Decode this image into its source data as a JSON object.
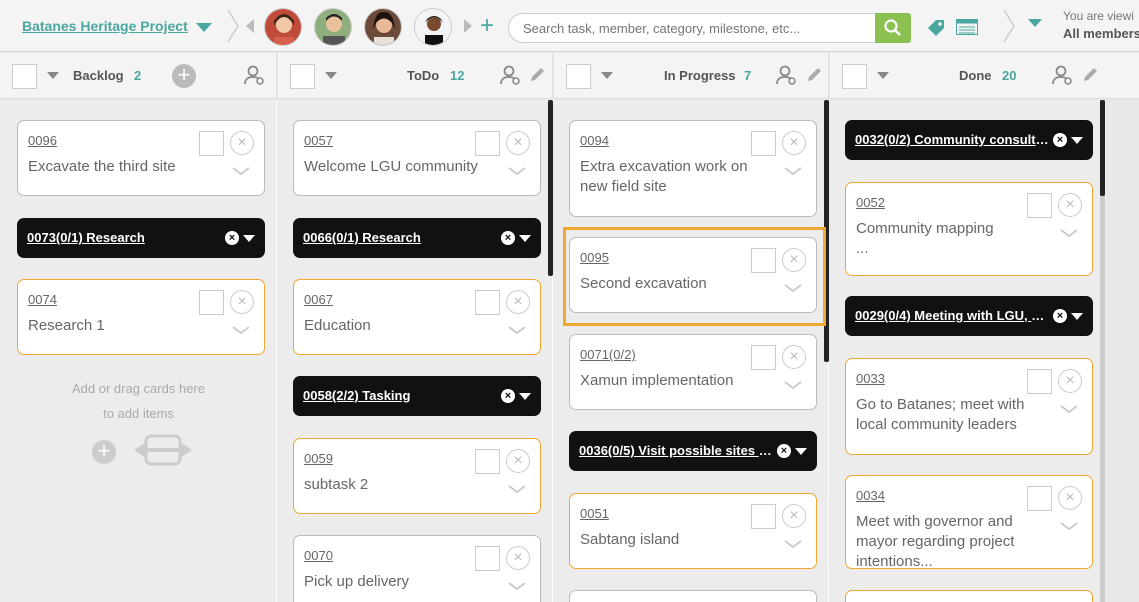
{
  "topbar": {
    "project_title": "Batanes Heritage Project",
    "search_placeholder": "Search task, member, category, milestone, etc...",
    "viewing_label": "You are viewi",
    "viewing_who": "All members"
  },
  "colors": {
    "accent": "#4aa7a0",
    "search_green": "#8cc152",
    "card_orange": "#f0a830",
    "group_black": "#111111"
  },
  "columns": [
    {
      "name": "Backlog",
      "count": "2"
    },
    {
      "name": "ToDo",
      "count": "12"
    },
    {
      "name": "In Progress",
      "count": "7"
    },
    {
      "name": "Done",
      "count": "20"
    }
  ],
  "backlog": {
    "cards": [
      {
        "id": "0096",
        "title": "Excavate the third site"
      },
      {
        "id": "0074",
        "title": "Research 1"
      }
    ],
    "groups": [
      {
        "title": "0073(0/1) Research"
      }
    ],
    "empty_hint_1": "Add or drag cards here",
    "empty_hint_2": "to add items"
  },
  "todo": {
    "cards": [
      {
        "id": "0057",
        "title": "Welcome LGU community"
      },
      {
        "id": "0067",
        "title": "Education"
      },
      {
        "id": "0059",
        "title": "subtask 2"
      },
      {
        "id": "0070",
        "title": "Pick up delivery"
      }
    ],
    "groups": [
      {
        "title": "0066(0/1) Research"
      },
      {
        "title": "0058(2/2) Tasking"
      }
    ]
  },
  "inprogress": {
    "cards": [
      {
        "id": "0094",
        "title": "Extra excavation work on new field site"
      },
      {
        "id": "0095",
        "title": "Second excavation"
      },
      {
        "id": "0071(0/2)",
        "title": "Xamun implementation"
      },
      {
        "id": "0051",
        "title": "Sabtang island"
      }
    ],
    "groups": [
      {
        "title": "0036(0/5) Visit possible sites fo..."
      }
    ]
  },
  "done": {
    "cards": [
      {
        "id": "0052",
        "title": "Community mapping",
        "extra": "..."
      },
      {
        "id": "0033",
        "title": "Go to Batanes; meet with local community leaders"
      },
      {
        "id": "0034",
        "title": "Meet with governor and mayor regarding project intentions..."
      }
    ],
    "groups": [
      {
        "title": "0032(0/2) Community consultat..."
      },
      {
        "title": "0029(0/4) Meeting with LGU, N..."
      }
    ]
  },
  "icons": {
    "remove": "×"
  }
}
